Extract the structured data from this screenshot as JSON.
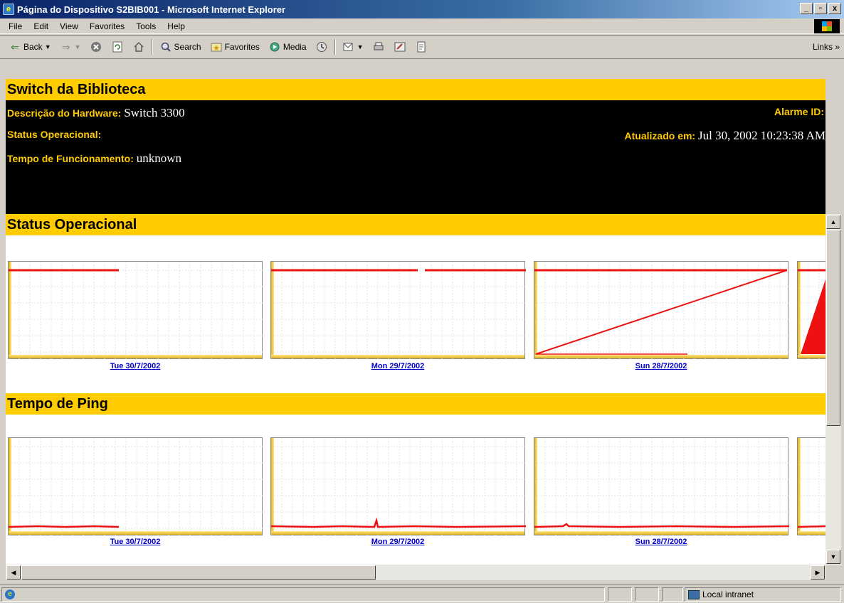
{
  "window": {
    "title": "Página do Dispositivo S2BIB001 - Microsoft Internet Explorer",
    "minimize": "_",
    "maximize": "▫",
    "close": "x"
  },
  "menu": [
    "File",
    "Edit",
    "View",
    "Favorites",
    "Tools",
    "Help"
  ],
  "toolbar": {
    "back_label": "Back",
    "search_label": "Search",
    "favorites_label": "Favorites",
    "media_label": "Media",
    "links_label": "Links »"
  },
  "header": {
    "device_name": "Switch da Biblioteca",
    "hw_desc_label": "Descrição do Hardware:",
    "hw_desc_value": "Switch 3300",
    "alarm_label": "Alarme ID:",
    "status_label": "Status Operacional:",
    "updated_label": "Atualizado em:",
    "updated_value": "Jul 30, 2002 10:23:38 AM",
    "uptime_label": "Tempo de Funcionamento:",
    "uptime_value": "unknown"
  },
  "sections": {
    "status_title": "Status Operacional",
    "ping_title": "Tempo de Ping"
  },
  "dates": [
    "Tue 30/7/2002",
    "Mon 29/7/2002",
    "Sun 28/7/2002"
  ],
  "statusbar": {
    "zone": "Local intranet"
  },
  "colors": {
    "accent_yellow": "#ffcc00",
    "line_red": "#ee1111",
    "link_blue": "#0000cc"
  }
}
